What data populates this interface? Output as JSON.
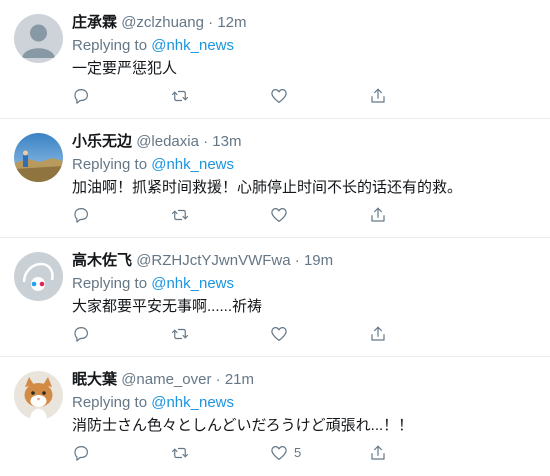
{
  "reply_prefix": "Replying to",
  "tweets": [
    {
      "name": "庄承霖",
      "handle": "@zclzhuang",
      "dot": "·",
      "time": "12m",
      "mention": "@nhk_news",
      "text": "一定要严惩犯人",
      "like_count": ""
    },
    {
      "name": "小乐无边",
      "handle": "@ledaxia",
      "dot": "·",
      "time": "13m",
      "mention": "@nhk_news",
      "text": "加油啊！抓紧时间救援！心肺停止时间不长的话还有的救。",
      "like_count": ""
    },
    {
      "name": "高木佐飞",
      "handle": "@RZHJctYJwnVWFwa",
      "dot": "·",
      "time": "19m",
      "mention": "@nhk_news",
      "text": "大家都要平安无事啊......祈祷",
      "like_count": ""
    },
    {
      "name": "眠大葉",
      "handle": "@name_over",
      "dot": "·",
      "time": "21m",
      "mention": "@nhk_news",
      "text": "消防士さん色々としんどいだろうけど頑張れ...！！",
      "like_count": "5"
    }
  ],
  "icons": {
    "reply": "reply-icon",
    "retweet": "retweet-icon",
    "like": "like-icon",
    "share": "share-icon"
  },
  "colors": {
    "link": "#1b95e0",
    "secondary_text": "#657786",
    "divider": "#e6ecf0"
  }
}
